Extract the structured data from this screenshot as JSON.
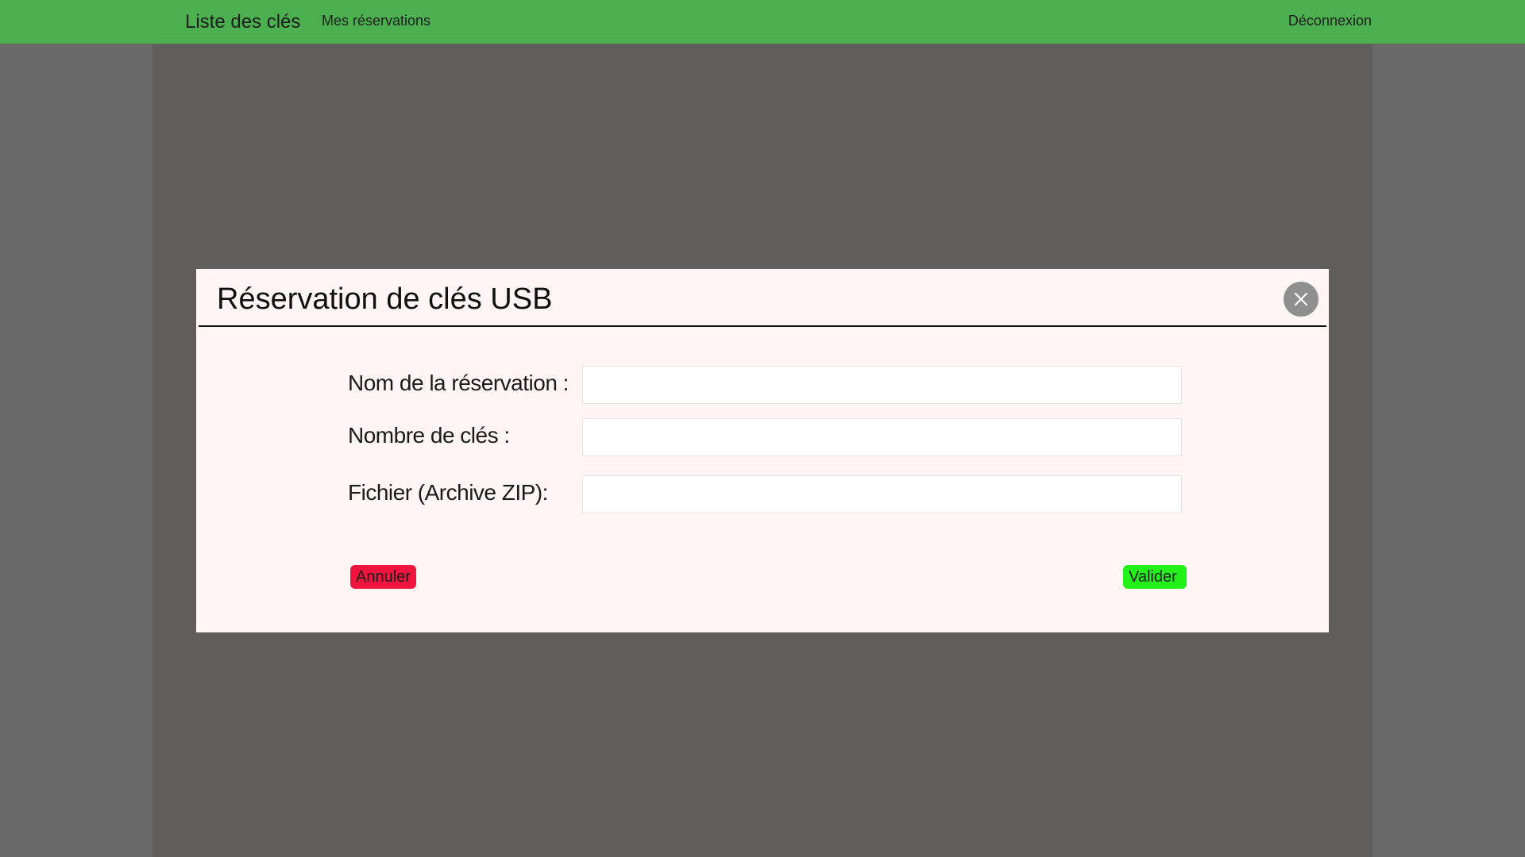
{
  "navbar": {
    "brand": "Liste des clés",
    "links": [
      {
        "label": "Mes réservations"
      },
      {
        "label": "Déconnexion"
      }
    ],
    "color": "#4caf50"
  },
  "modal": {
    "title": "Réservation de clés USB",
    "close_icon": "close-icon",
    "fields": [
      {
        "label": "Nom de la réservation :",
        "value": "",
        "placeholder": ""
      },
      {
        "label": "Nombre de clés :",
        "value": "",
        "placeholder": ""
      },
      {
        "label": "Fichier (Archive ZIP):",
        "value": "",
        "placeholder": ""
      }
    ],
    "cancel_label": "Annuler",
    "submit_label": "Valider",
    "cancel_color": "#f0153f",
    "submit_color": "#22f21a"
  }
}
